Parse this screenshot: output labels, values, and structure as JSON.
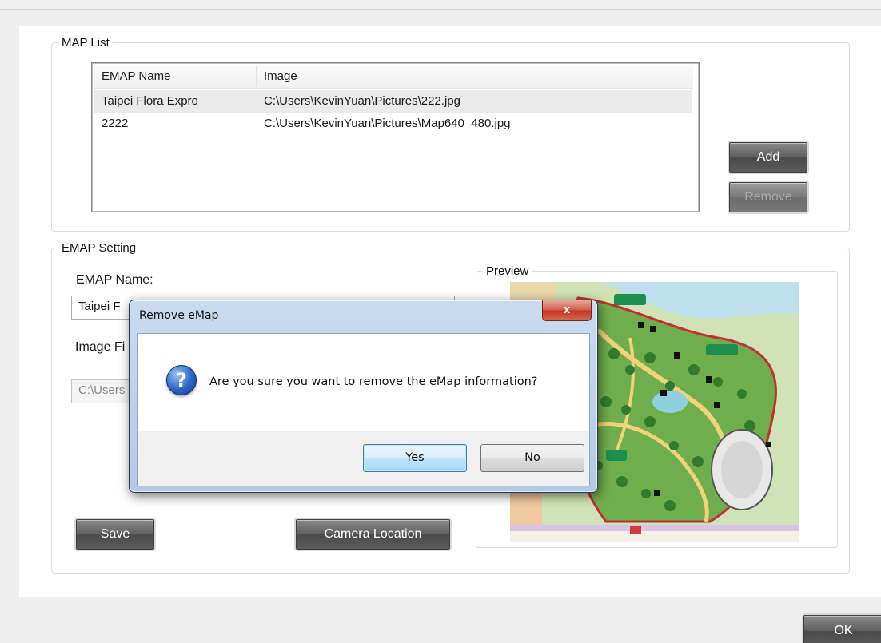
{
  "map_list": {
    "legend": "MAP List",
    "columns": [
      "EMAP Name",
      "Image"
    ],
    "rows": [
      {
        "name": "Taipei Flora Expro",
        "image": "C:\\Users\\KevinYuan\\Pictures\\222.jpg"
      },
      {
        "name": "2222",
        "image": "C:\\Users\\KevinYuan\\Pictures\\Map640_480.jpg"
      }
    ],
    "add_label": "Add",
    "remove_label": "Remove"
  },
  "emap_setting": {
    "legend": "EMAP Setting",
    "name_label": "EMAP Name:",
    "name_value": "Taipei F",
    "image_label": "Image Fi",
    "image_value": "C:\\Users",
    "save_label": "Save",
    "camera_location_label": "Camera Location",
    "preview_legend": "Preview"
  },
  "ok_label": "OK",
  "dialog": {
    "title": "Remove eMap",
    "close_glyph": "x",
    "message": "Are you sure you want to remove the eMap information?",
    "icon_glyph": "?",
    "yes_label": "Yes",
    "no_label": "No",
    "no_mnemonic": "N",
    "no_rest": "o"
  },
  "colors": {
    "accent_dark_button": "#5e5e5e",
    "dialog_frame": "#b3c9e4",
    "close_red": "#c2361d",
    "selection": "#eaeaea"
  }
}
